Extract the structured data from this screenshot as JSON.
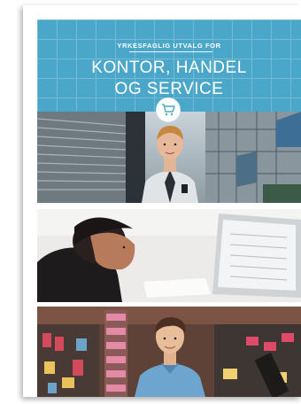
{
  "cover": {
    "subtitle": "YRKESFAGLIG UTVALG FOR",
    "title_line1": "KONTOR, HANDEL",
    "title_line2": "OG SERVICE"
  },
  "icons": {
    "badge": "shopping-cart-icon"
  },
  "colors": {
    "header_bg": "#4aa7c9",
    "text": "#ffffff"
  }
}
